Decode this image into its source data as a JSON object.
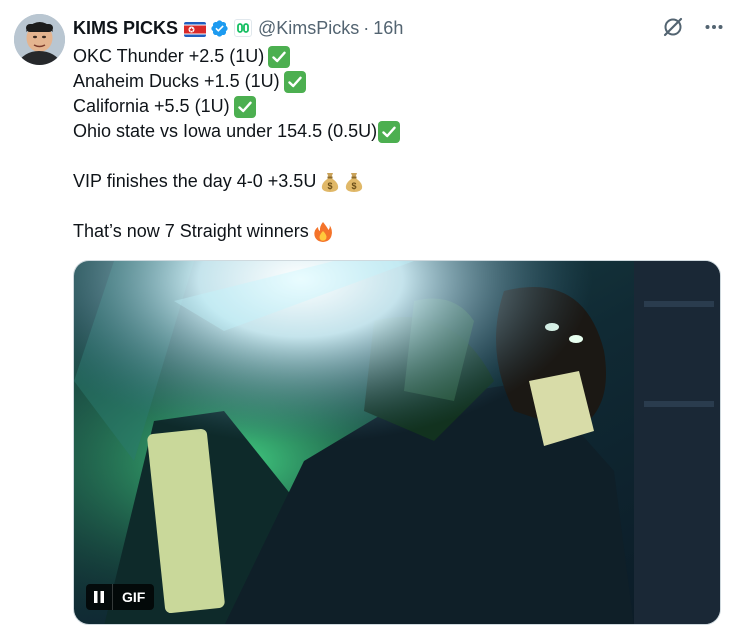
{
  "author": {
    "name": "KIMS PICKS",
    "handle": "@KimsPicks",
    "separator": "·",
    "time": "16h"
  },
  "tweet": {
    "lines": [
      "OKC Thunder +2.5 (1U)",
      "Anaheim Ducks +1.5 (1U)",
      "California +5.5 (1U)",
      "Ohio state vs Iowa under 154.5 (0.5U)",
      "VIP finishes the day 4-0 +3.5U",
      "That’s now 7 Straight winners"
    ]
  },
  "media": {
    "badge_label": "GIF"
  },
  "icons": {
    "flag": "north-korea-flag",
    "verified": "verified-badge-icon",
    "affiliation": "affiliate-badge-icon",
    "grok": "grok-icon",
    "more": "more-icon",
    "check": "check-mark-emoji",
    "money": "money-bag-emoji",
    "fire": "fire-emoji",
    "pause": "pause-icon"
  },
  "colors": {
    "verified": "#1d9bf0",
    "check": "#4caf50",
    "muted": "#536471"
  }
}
